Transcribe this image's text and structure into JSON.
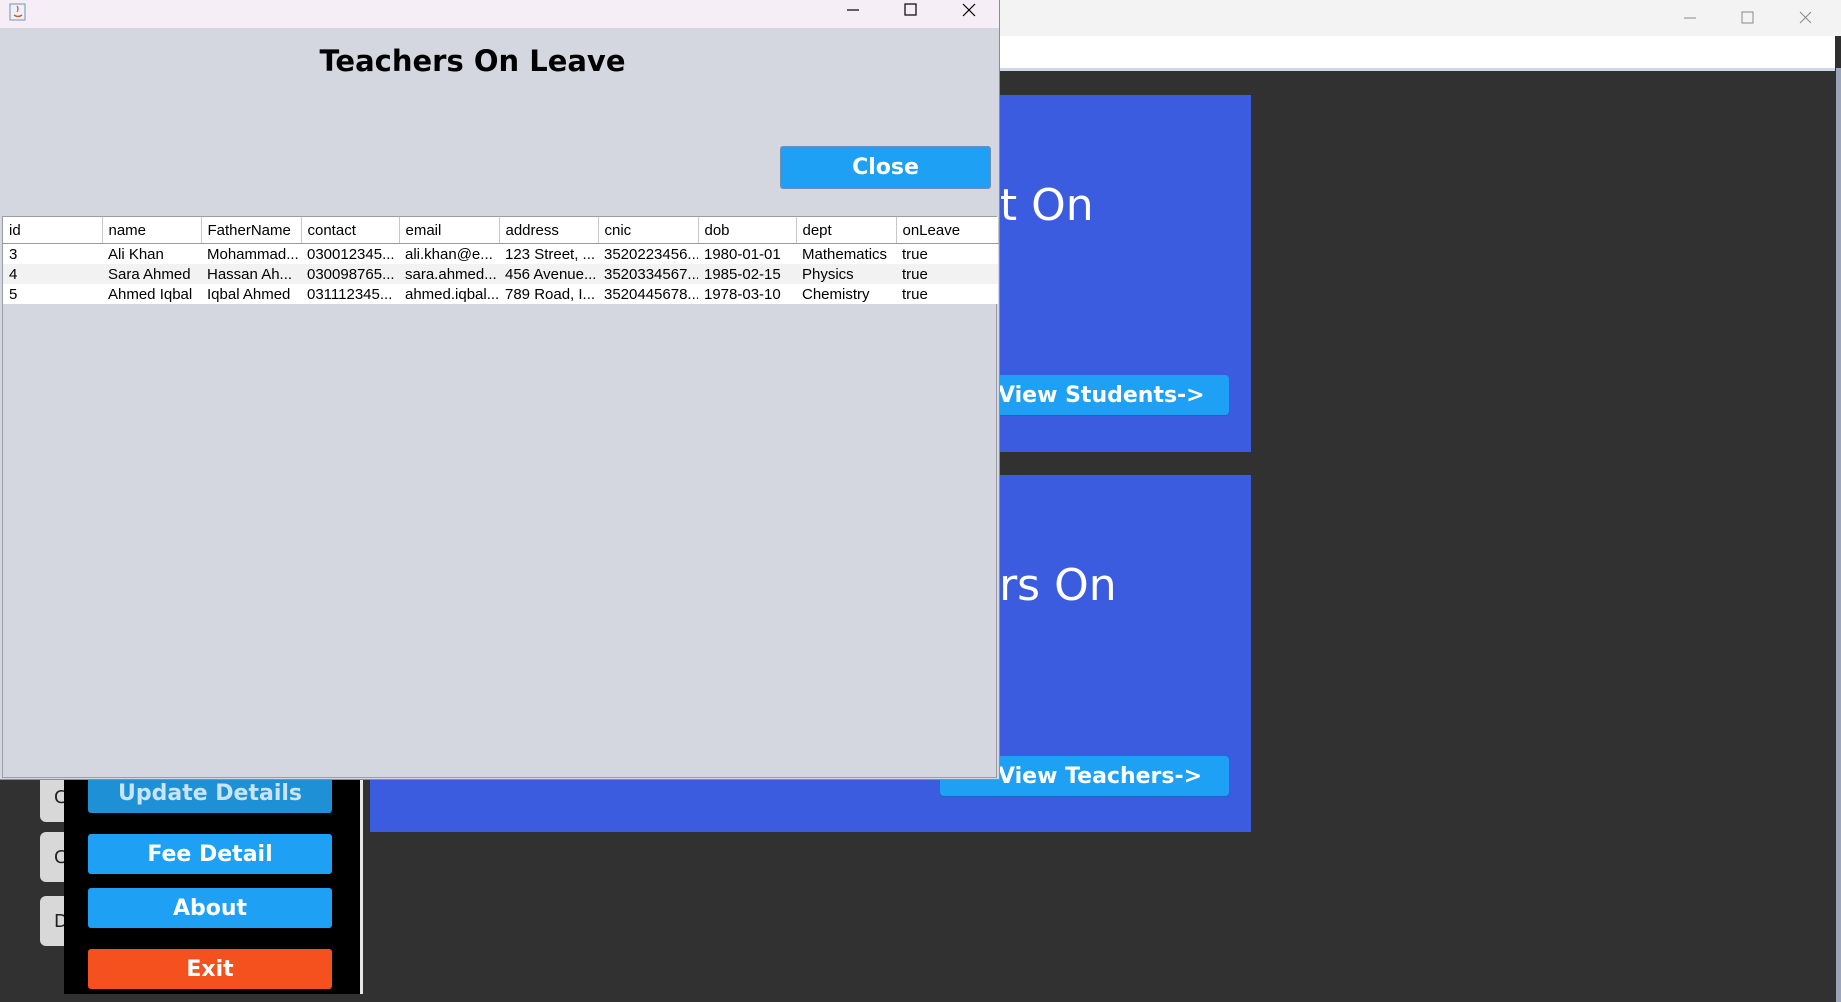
{
  "main_window": {
    "cards": [
      {
        "text": "nt On",
        "button": "View Students->"
      },
      {
        "text": "ers On",
        "button": "View Teachers->"
      }
    ]
  },
  "sidebar": {
    "buttons": [
      {
        "label": "Update Details",
        "color": "#1ea0f5"
      },
      {
        "label": "Fee Detail",
        "color": "#1ea0f5"
      },
      {
        "label": "About",
        "color": "#1ea0f5"
      },
      {
        "label": "Exit",
        "color": "#f4511e"
      }
    ],
    "ghost_tabs": [
      "C",
      "C",
      "D"
    ]
  },
  "dialog": {
    "title": "Teachers On Leave",
    "close_label": "Close",
    "table": {
      "columns": [
        "id",
        "name",
        "FatherName",
        "contact",
        "email",
        "address",
        "cnic",
        "dob",
        "dept",
        "onLeave"
      ],
      "rows": [
        [
          "3",
          "Ali Khan",
          "Mohammad...",
          "030012345...",
          "ali.khan@e...",
          "123 Street, ...",
          "3520223456...",
          "1980-01-01",
          "Mathematics",
          "true"
        ],
        [
          "4",
          "Sara Ahmed",
          "Hassan Ah...",
          "030098765...",
          "sara.ahmed...",
          "456 Avenue...",
          "3520334567...",
          "1985-02-15",
          "Physics",
          "true"
        ],
        [
          "5",
          "Ahmed Iqbal",
          "Iqbal Ahmed",
          "031112345...",
          "ahmed.iqbal...",
          "789 Road, I...",
          "3520445678...",
          "1978-03-10",
          "Chemistry",
          "true"
        ]
      ]
    }
  },
  "colors": {
    "card_blue": "#3c5ce0",
    "button_blue": "#1ea0f5",
    "exit_orange": "#f4511e"
  }
}
